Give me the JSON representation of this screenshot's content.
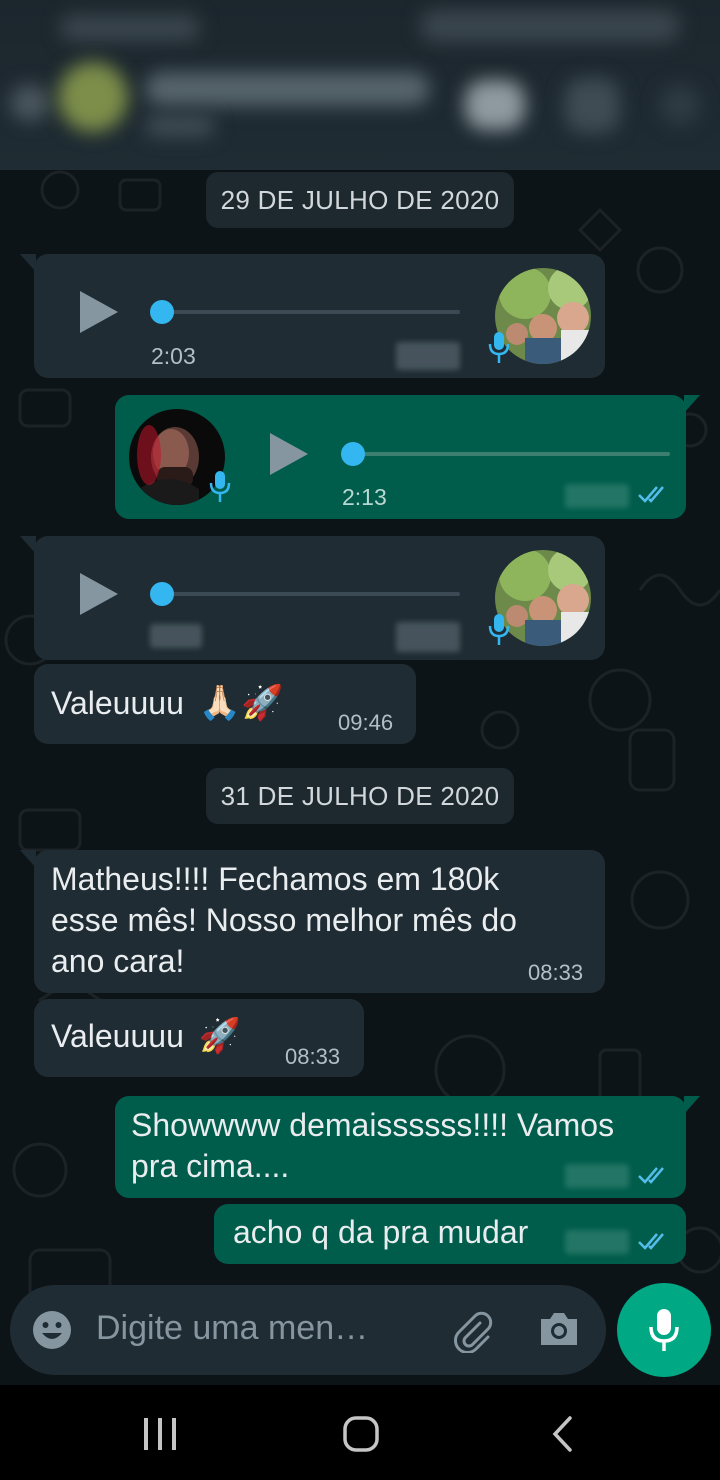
{
  "dates": [
    "29 DE JULHO DE 2020",
    "31 DE JULHO DE 2020"
  ],
  "audio_messages": [
    {
      "direction": "incoming",
      "duration": "2:03",
      "progress": 0
    },
    {
      "direction": "outgoing",
      "duration": "2:13",
      "progress": 0,
      "status": "read"
    },
    {
      "direction": "incoming",
      "duration": "",
      "progress": 0
    }
  ],
  "text_messages": [
    {
      "direction": "incoming",
      "text": "Valeuuuu",
      "emoji": "🙏🏻🚀",
      "time": "09:46"
    },
    {
      "direction": "incoming",
      "lines": [
        "Matheus!!!! Fechamos em 180k",
        "esse mês! Nosso melhor mês do",
        "ano cara!"
      ],
      "time": "08:33"
    },
    {
      "direction": "incoming",
      "text": "Valeuuuu",
      "emoji": "🚀",
      "time": "08:33"
    },
    {
      "direction": "outgoing",
      "lines": [
        "Showwww demaissssss!!!! Vamos",
        "pra cima...."
      ],
      "status": "read"
    },
    {
      "direction": "outgoing",
      "text": "acho q da pra mudar",
      "status": "read"
    }
  ],
  "composer": {
    "placeholder": "Digite uma men…"
  },
  "icons": [
    "emoji-icon",
    "attach-icon",
    "camera-icon",
    "mic-icon",
    "play-icon",
    "double-check-icon",
    "recents-icon",
    "home-icon",
    "back-icon"
  ],
  "colors": {
    "outgoing_bubble": "#005c4b",
    "incoming_bubble": "#1f2c33",
    "read_ticks": "#53bdeb",
    "accent": "#00a884"
  }
}
